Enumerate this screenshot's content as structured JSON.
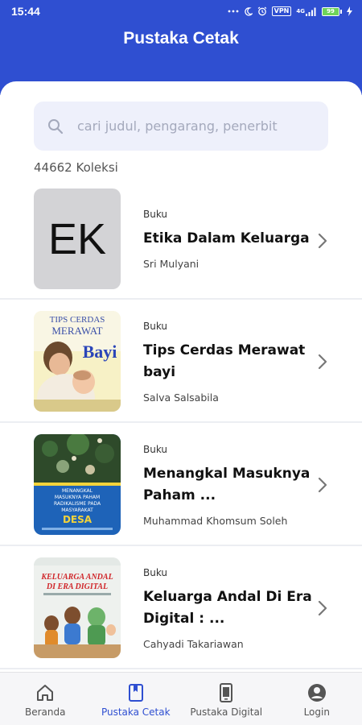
{
  "status_bar": {
    "time": "15:44",
    "icons": [
      "dots-icon",
      "moon-icon",
      "alarm-icon",
      "vpn-icon",
      "signal-icon",
      "battery-icon",
      "charging-icon"
    ],
    "vpn_label": "VPN",
    "network_label": "4G",
    "battery": {
      "label": "99",
      "level": 0.99
    }
  },
  "header": {
    "title": "Pustaka Cetak",
    "color": "#2f4fd1"
  },
  "search": {
    "placeholder": "cari judul, pengarang, penerbit",
    "value": ""
  },
  "collection_count": "44662 Koleksi",
  "books": [
    {
      "cover_type": "initials",
      "cover_initials": "EK",
      "category": "Buku",
      "title": "Etika Dalam Keluarga",
      "author": "Sri Mulyani"
    },
    {
      "cover_type": "image",
      "cover_text": [
        "TIPS CERDAS",
        "MERAWAT",
        "Bayi"
      ],
      "category": "Buku",
      "title": "Tips Cerdas Merawat bayi",
      "author": "Salva Salsabila"
    },
    {
      "cover_type": "image",
      "cover_text": [
        "MENANGKAL",
        "MASUKNYA PAHAM",
        "RADIKALISME PADA",
        "MASYARAKAT",
        "DESA"
      ],
      "category": "Buku",
      "title": "Menangkal Masuknya Paham ...",
      "author": "Muhammad Khomsum Soleh"
    },
    {
      "cover_type": "image",
      "cover_text": [
        "KELUARGA ANDAL",
        "DI ERA DIGITAL"
      ],
      "category": "Buku",
      "title": "Keluarga Andal Di Era Digital : ...",
      "author": "Cahyadi Takariawan"
    }
  ],
  "bottom_nav": [
    {
      "label": "Beranda",
      "icon": "home-icon",
      "active": false
    },
    {
      "label": "Pustaka Cetak",
      "icon": "book-icon",
      "active": true
    },
    {
      "label": "Pustaka Digital",
      "icon": "tablet-icon",
      "active": false
    },
    {
      "label": "Login",
      "icon": "user-icon",
      "active": false
    }
  ]
}
